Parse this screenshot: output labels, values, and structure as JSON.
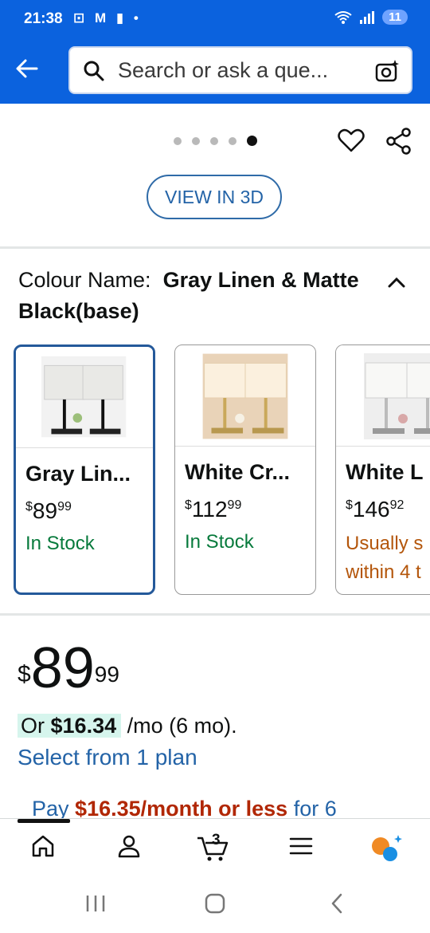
{
  "status": {
    "time": "21:38",
    "icons": "⊡ M ▮ •",
    "battery": "11"
  },
  "search": {
    "placeholder": "Search or ask a que..."
  },
  "gallery": {
    "dots": 5,
    "active_dot": 5
  },
  "view3d_label": "VIEW IN 3D",
  "colour": {
    "label": "Colour Name:",
    "value": "Gray Linen & Matte Black(base)"
  },
  "variants": [
    {
      "name": "Gray Lin...",
      "price_whole": "89",
      "price_cents": "99",
      "currency": "$",
      "stock": "In Stock"
    },
    {
      "name": "White Cr...",
      "price_whole": "112",
      "price_cents": "99",
      "currency": "$",
      "stock": "In Stock"
    },
    {
      "name": "White L",
      "price_whole": "146",
      "price_cents": "92",
      "currency": "$",
      "stock": "Usually s within 4 t"
    }
  ],
  "price": {
    "currency": "$",
    "whole": "89",
    "cents": "99"
  },
  "monthly": {
    "prefix": "Or",
    "amount": "$16.34",
    "suffix": "/mo (6 mo)."
  },
  "plan_link": "Select from 1 plan",
  "pay": {
    "prefix": "Pay",
    "amount": "$16.35/month or less",
    "suffix": "for 6"
  },
  "nav": [
    "home-icon",
    "account-icon",
    "cart-icon",
    "menu-icon",
    "rufus-icon"
  ],
  "cart_count": "3",
  "colors": {
    "brand": "#0b62de",
    "link": "#2363a7",
    "stock": "#077a3c",
    "warn": "#b4560b",
    "deal": "#b12704"
  }
}
